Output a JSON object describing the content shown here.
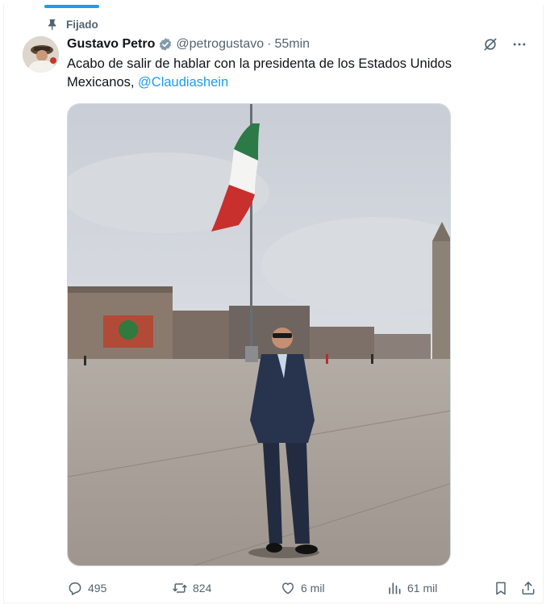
{
  "pinned": {
    "label": "Fijado",
    "icon": "pin-icon"
  },
  "author": {
    "name": "Gustavo Petro",
    "handle": "@petrogustavo",
    "separator": "·",
    "time": "55min",
    "verified_icon": "verified-badge-icon"
  },
  "tweet": {
    "text": "Acabo de salir de hablar con la presidenta de los Estados Unidos Mexicanos, ",
    "mention": "@Claudiashein"
  },
  "header_actions": {
    "grok_icon": "grok-icon",
    "more_icon": "more-icon"
  },
  "stats": {
    "replies": "495",
    "reposts": "824",
    "likes": "6 mil",
    "views": "61 mil"
  },
  "colors": {
    "accent": "#1d9bf0",
    "text": "#0f1419",
    "secondary": "#536471",
    "border": "#eff3f4"
  }
}
